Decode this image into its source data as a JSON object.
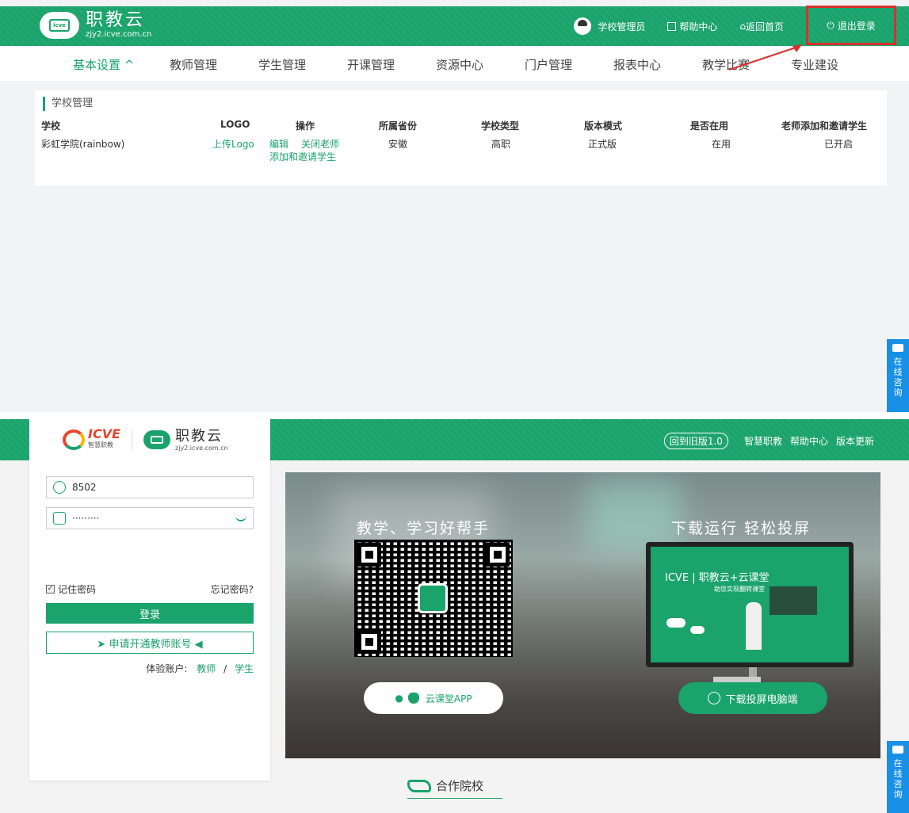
{
  "top": {
    "header": {
      "logo_title": "职教云",
      "logo_url": "zjy2.icve.com.cn",
      "logo_badge": "icve",
      "user": "学校管理员",
      "help": "帮助中心",
      "home": "返回首页",
      "logout": "退出登录"
    },
    "nav": [
      {
        "label": "基本设置 ^"
      },
      {
        "label": "教师管理"
      },
      {
        "label": "学生管理"
      },
      {
        "label": "开课管理"
      },
      {
        "label": "资源中心"
      },
      {
        "label": "门户管理"
      },
      {
        "label": "报表中心"
      },
      {
        "label": "教学比赛"
      },
      {
        "label": "专业建设"
      }
    ],
    "panel": {
      "title": "学校管理",
      "columns": [
        "学校",
        "LOGO",
        "操作",
        "所属省份",
        "学校类型",
        "版本模式",
        "是否在用",
        "老师添加和邀请学生"
      ],
      "row": {
        "school": "彩虹学院(rainbow)",
        "logo": "上传Logo",
        "op_edit": "编辑",
        "op_close": "关闭老师",
        "op_close2": "添加和邀请学生",
        "province": "安徽",
        "type": "高职",
        "mode": "正式版",
        "in_use": "在用",
        "invite": "已开启"
      }
    },
    "chat": {
      "c1": "在",
      "c2": "线",
      "c3": "咨",
      "c4": "询"
    }
  },
  "bottom": {
    "header": {
      "icve_brand": "ICVE",
      "icve_sub": "智慧职教",
      "logo_title": "职教云",
      "logo_url": "zjy2.icve.com.cn",
      "old_version": "回到旧版1.0",
      "smart": "智慧职教",
      "help": "帮助中心",
      "update": "版本更新"
    },
    "login": {
      "username": "8502",
      "password": "·········",
      "remember": "记住密码",
      "forgot": "忘记密码?",
      "login_btn": "登录",
      "apply_btn": "➤ 申请开通教师账号 ◀",
      "trial_label": "体验账户:",
      "trial_teacher": "教师",
      "trial_sep": "/",
      "trial_student": "学生"
    },
    "banner": {
      "left_heading": "教学、学习好帮手",
      "right_heading": "下载运行 轻松投屏",
      "monitor_brand": "ICVE | 职教云+云课堂",
      "monitor_sub": "助您实现翻转课堂",
      "app_btn": "云课堂APP",
      "download_btn": "下载投屏电脑端"
    },
    "partner": "合作院校",
    "chat": {
      "c1": "在",
      "c2": "线",
      "c3": "咨",
      "c4": "询"
    }
  },
  "colors": {
    "brand_green": "#1aa36b",
    "highlight_red": "#d9302c",
    "chat_blue": "#1890e6"
  }
}
